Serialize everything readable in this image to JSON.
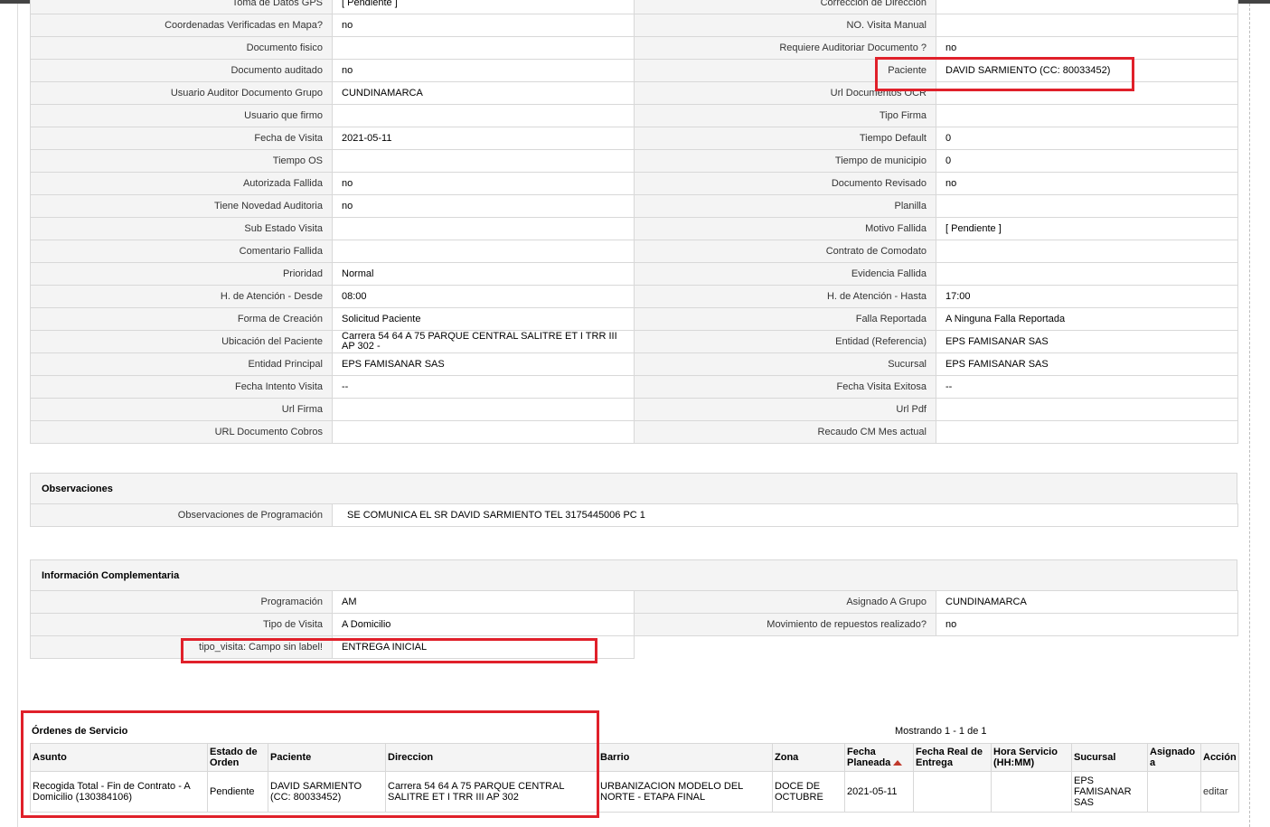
{
  "detail_rows": [
    {
      "l1": "Toma de Datos GPS",
      "v1": "[ Pendiente ]",
      "l2": "Corrección de Dirección",
      "v2": ""
    },
    {
      "l1": "Coordenadas Verificadas en Mapa?",
      "v1": "no",
      "l2": "NO. Visita Manual",
      "v2": ""
    },
    {
      "l1": "Documento fisico",
      "v1": "",
      "l2": "Requiere Auditoriar Documento ?",
      "v2": "no"
    },
    {
      "l1": "Documento auditado",
      "v1": "no",
      "l2": "Paciente",
      "v2": "DAVID SARMIENTO (CC: 80033452)"
    },
    {
      "l1": "Usuario Auditor Documento Grupo",
      "v1": "CUNDINAMARCA",
      "l2": "Url Documentos OCR",
      "v2": ""
    },
    {
      "l1": "Usuario que firmo",
      "v1": "",
      "l2": "Tipo Firma",
      "v2": ""
    },
    {
      "l1": "Fecha de Visita",
      "v1": "2021-05-11",
      "l2": "Tiempo Default",
      "v2": "0"
    },
    {
      "l1": "Tiempo OS",
      "v1": "",
      "l2": "Tiempo de municipio",
      "v2": "0"
    },
    {
      "l1": "Autorizada Fallida",
      "v1": "no",
      "l2": "Documento Revisado",
      "v2": "no"
    },
    {
      "l1": "Tiene Novedad Auditoria",
      "v1": "no",
      "l2": "Planilla",
      "v2": ""
    },
    {
      "l1": "Sub Estado Visita",
      "v1": "",
      "l2": "Motivo Fallida",
      "v2": "[ Pendiente ]"
    },
    {
      "l1": "Comentario Fallida",
      "v1": "",
      "l2": "Contrato de Comodato",
      "v2": ""
    },
    {
      "l1": "Prioridad",
      "v1": "Normal",
      "l2": "Evidencia Fallida",
      "v2": ""
    },
    {
      "l1": "H. de Atención - Desde",
      "v1": "08:00",
      "l2": "H. de Atención - Hasta",
      "v2": "17:00"
    },
    {
      "l1": "Forma de Creación",
      "v1": "Solicitud Paciente",
      "l2": "Falla Reportada",
      "v2": "A Ninguna Falla Reportada"
    },
    {
      "l1": "Ubicación del Paciente",
      "v1": "Carrera 54 64 A 75 PARQUE CENTRAL SALITRE ET I TRR III AP 302 -",
      "l2": "Entidad (Referencia)",
      "v2": "EPS FAMISANAR SAS"
    },
    {
      "l1": "Entidad Principal",
      "v1": "EPS FAMISANAR SAS",
      "l2": "Sucursal",
      "v2": "EPS FAMISANAR SAS"
    },
    {
      "l1": "Fecha Intento Visita",
      "v1": "--",
      "l2": "Fecha Visita Exitosa",
      "v2": "--"
    },
    {
      "l1": "Url Firma",
      "v1": "",
      "l2": "Url Pdf",
      "v2": ""
    },
    {
      "l1": "URL Documento Cobros",
      "v1": "",
      "l2": "Recaudo CM Mes actual",
      "v2": ""
    }
  ],
  "observaciones": {
    "title": "Observaciones",
    "label": "Observaciones de Programación",
    "value": "SE COMUNICA EL SR DAVID SARMIENTO TEL 3175445006 PC 1"
  },
  "complementaria": {
    "title": "Información Complementaria",
    "rows": [
      {
        "l1": "Programación",
        "v1": "AM",
        "l2": "Asignado A Grupo",
        "v2": "CUNDINAMARCA"
      },
      {
        "l1": "Tipo de Visita",
        "v1": "A Domicilio",
        "l2": "Movimiento de repuestos realizado?",
        "v2": "no"
      },
      {
        "l1": "tipo_visita: Campo sin label!",
        "v1": "ENTREGA INICIAL"
      }
    ]
  },
  "orders": {
    "title": "Órdenes de Servicio",
    "count": "Mostrando 1 - 1 de 1",
    "headers": [
      "Asunto",
      "Estado de Orden",
      "Paciente",
      "Direccion",
      "Barrio",
      "Zona",
      "Fecha Planeada",
      "Fecha Real de Entrega",
      "Hora Servicio (HH:MM)",
      "Sucursal",
      "Asignado a",
      "Acción"
    ],
    "row": {
      "asunto": "Recogida Total - Fin de Contrato - A Domicilio (130384106)",
      "estado": "Pendiente",
      "paciente": "DAVID SARMIENTO (CC: 80033452)",
      "direccion": "Carrera 54 64 A 75 PARQUE CENTRAL SALITRE ET I TRR III AP 302",
      "barrio": "URBANIZACION MODELO DEL NORTE - ETAPA FINAL",
      "zona": "DOCE DE OCTUBRE",
      "fecha_planeada": "2021-05-11",
      "fecha_real": "",
      "hora": "",
      "sucursal": "EPS FAMISANAR SAS",
      "asignado": "",
      "accion": "editar"
    }
  },
  "highlight_color": "#e0202a"
}
